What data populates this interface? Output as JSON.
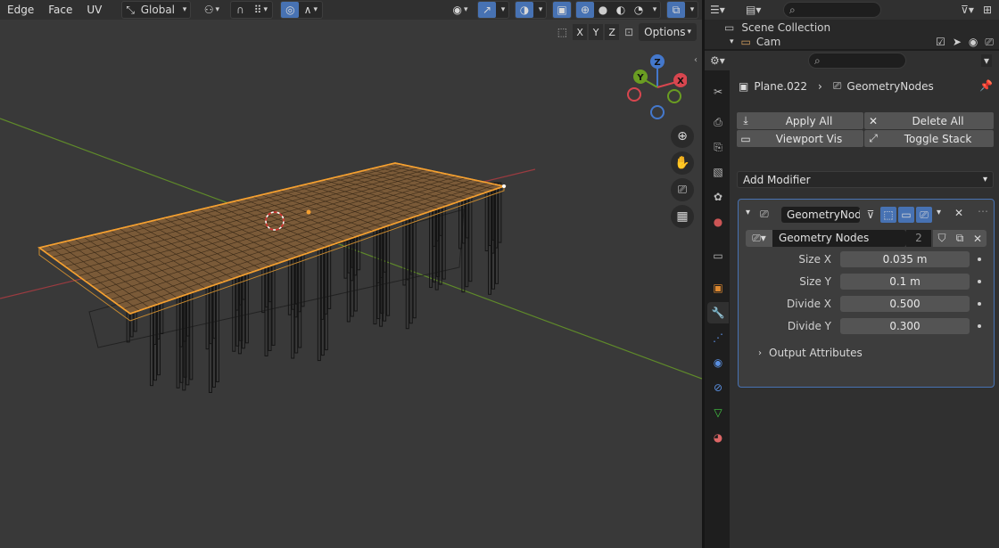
{
  "viewport": {
    "menu": [
      "Edge",
      "Face",
      "UV"
    ],
    "orientation": "Global",
    "axes": [
      "X",
      "Y",
      "Z"
    ],
    "options_label": "Options",
    "gizmo": {
      "x": "X",
      "y": "Y",
      "z": "Z"
    },
    "nav_icons": [
      "zoom-icon",
      "hand-pan-icon",
      "camera-icon",
      "grid-ortho-icon"
    ]
  },
  "outliner": {
    "search_placeholder": "",
    "items": [
      {
        "label": "Scene Collection"
      },
      {
        "label": "Cam"
      }
    ]
  },
  "properties": {
    "search_placeholder": "",
    "breadcrumb": {
      "object": "Plane.022",
      "modifier": "GeometryNodes"
    },
    "buttons": {
      "apply_all": "Apply All",
      "delete_all": "Delete All",
      "viewport_vis": "Viewport Vis",
      "toggle_stack": "Toggle Stack"
    },
    "add_modifier": "Add Modifier",
    "modifier": {
      "name": "GeometryNod...",
      "node_group": "Geometry Nodes",
      "users": "2",
      "inputs": [
        {
          "label": "Size X",
          "value": "0.035 m"
        },
        {
          "label": "Size Y",
          "value": "0.1 m"
        },
        {
          "label": "Divide X",
          "value": "0.500"
        },
        {
          "label": "Divide Y",
          "value": "0.300"
        }
      ],
      "output_attributes": "Output Attributes"
    }
  },
  "colors": {
    "accent": "#4772b3",
    "selection": "#f5a030",
    "x_axis": "#d8464f",
    "y_axis": "#6a9d22",
    "z_axis": "#4478cc"
  }
}
